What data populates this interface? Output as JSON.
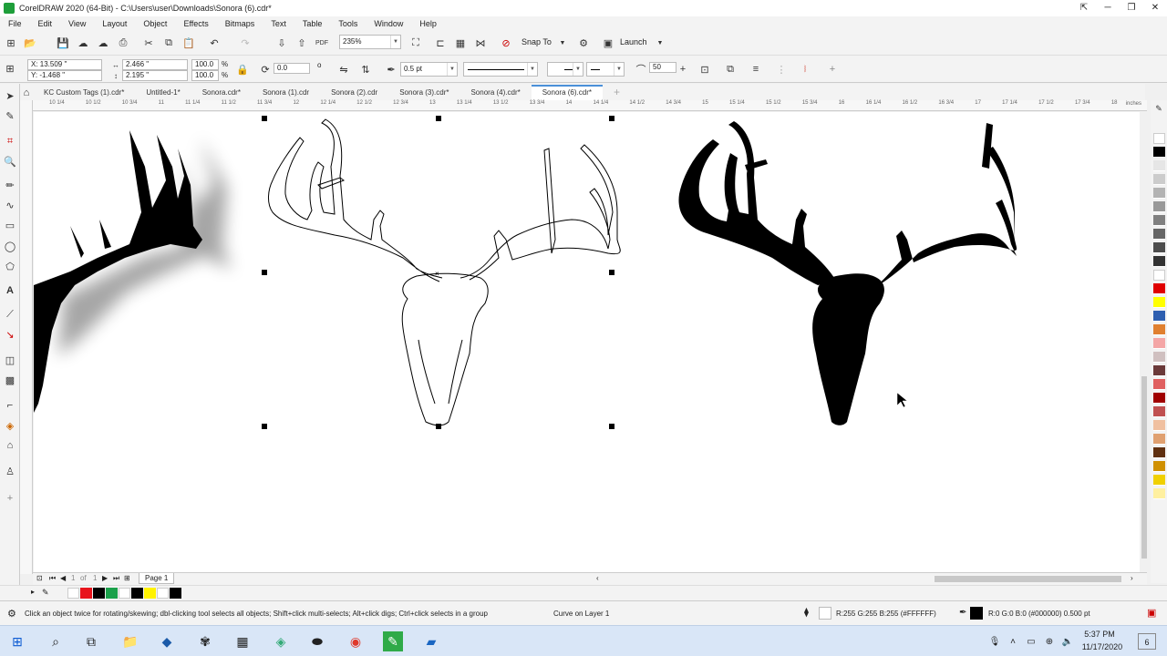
{
  "window": {
    "title": "CorelDRAW 2020 (64-Bit) - C:\\Users\\user\\Downloads\\Sonora (6).cdr*"
  },
  "menu": [
    "File",
    "Edit",
    "View",
    "Layout",
    "Object",
    "Effects",
    "Bitmaps",
    "Text",
    "Table",
    "Tools",
    "Window",
    "Help"
  ],
  "toolbar1": {
    "zoom": "235%",
    "snap_to": "Snap To",
    "launch": "Launch"
  },
  "toolbar2": {
    "x": "X: 13.509 \"",
    "y": "Y: -1.468 \"",
    "w": "2.466 \"",
    "h": "2.195 \"",
    "scale_w": "100.0",
    "scale_h": "100.0",
    "pct": "%",
    "angle": "0.0",
    "degree": "o",
    "outline_width": "0.5 pt",
    "miter": "50"
  },
  "tabs": [
    "KC Custom Tags (1).cdr*",
    "Untitled-1*",
    "Sonora.cdr*",
    "Sonora (1).cdr",
    "Sonora (2).cdr",
    "Sonora (3).cdr*",
    "Sonora (4).cdr*",
    "Sonora (6).cdr*"
  ],
  "active_tab": 7,
  "ruler": {
    "unit": "inches",
    "ticks": [
      "10 1/4",
      "10 1/2",
      "10 3/4",
      "11",
      "11 1/4",
      "11 1/2",
      "11 3/4",
      "12",
      "12 1/4",
      "12 1/2",
      "12 3/4",
      "13",
      "13 1/4",
      "13 1/2",
      "13 3/4",
      "14",
      "14 1/4",
      "14 1/2",
      "14 3/4",
      "15",
      "15 1/4",
      "15 1/2",
      "15 3/4",
      "16",
      "16 1/4",
      "16 1/2",
      "16 3/4",
      "17",
      "17 1/4",
      "17 1/2",
      "17 3/4",
      "18"
    ]
  },
  "pager": {
    "current": "1",
    "of": "of",
    "total": "1",
    "page_label": "Page 1"
  },
  "status": {
    "hint": "Click an object twice for rotating/skewing; dbl-clicking tool selects all objects; Shift+click multi-selects; Alt+click digs; Ctrl+click selects in a group",
    "object_info": "Curve on Layer 1",
    "fill": "R:255 G:255 B:255 (#FFFFFF)",
    "outline": "R:0 G:0 B:0 (#000000)  0.500 pt"
  },
  "taskbar": {
    "time": "5:37 PM",
    "date": "11/17/2020",
    "notifications": "6"
  },
  "colors": {
    "accent": "#4a90d9",
    "palette": [
      "#ffffff",
      "#000000",
      "#e6e6e6",
      "#cccccc",
      "#b3b3b3",
      "#999999",
      "#808080",
      "#666666",
      "#4d4d4d",
      "#333333",
      "#ffffff",
      "#e00000",
      "#ffff00",
      "#2e5fb0",
      "#e08030",
      "#f4a6a6",
      "#d0c0c0",
      "#6b3a3a",
      "#e06060",
      "#a00000",
      "#c05050",
      "#f0c0a0",
      "#e0a070",
      "#603010",
      "#d09000",
      "#f0d000",
      "#fff0a0"
    ],
    "doc_palette": [
      "#ffffff",
      "#e8141c",
      "#000000",
      "#1aa04a",
      "#ffffff",
      "#000000",
      "#fff200",
      "#ffffff",
      "#000000"
    ]
  }
}
